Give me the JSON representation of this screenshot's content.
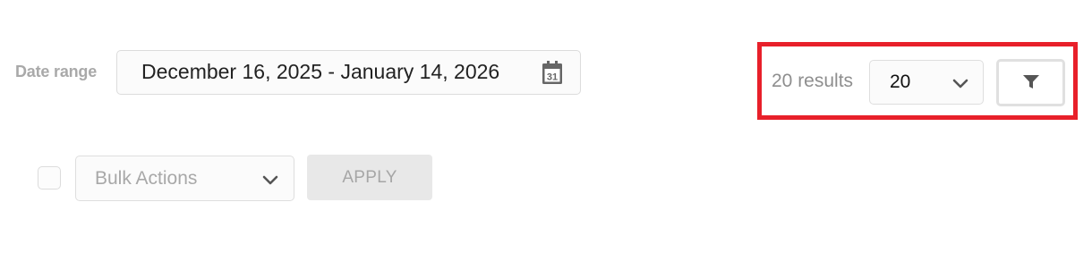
{
  "date_range": {
    "label": "Date range",
    "value": "December 16, 2025 - January 14, 2026",
    "icon": "calendar-icon",
    "calendar_day": "31"
  },
  "results": {
    "count_text": "20 results",
    "per_page_value": "20",
    "filter_icon": "funnel-icon",
    "highlight_color": "#e8202a"
  },
  "bulk": {
    "placeholder": "Bulk Actions",
    "apply_label": "APPLY"
  }
}
